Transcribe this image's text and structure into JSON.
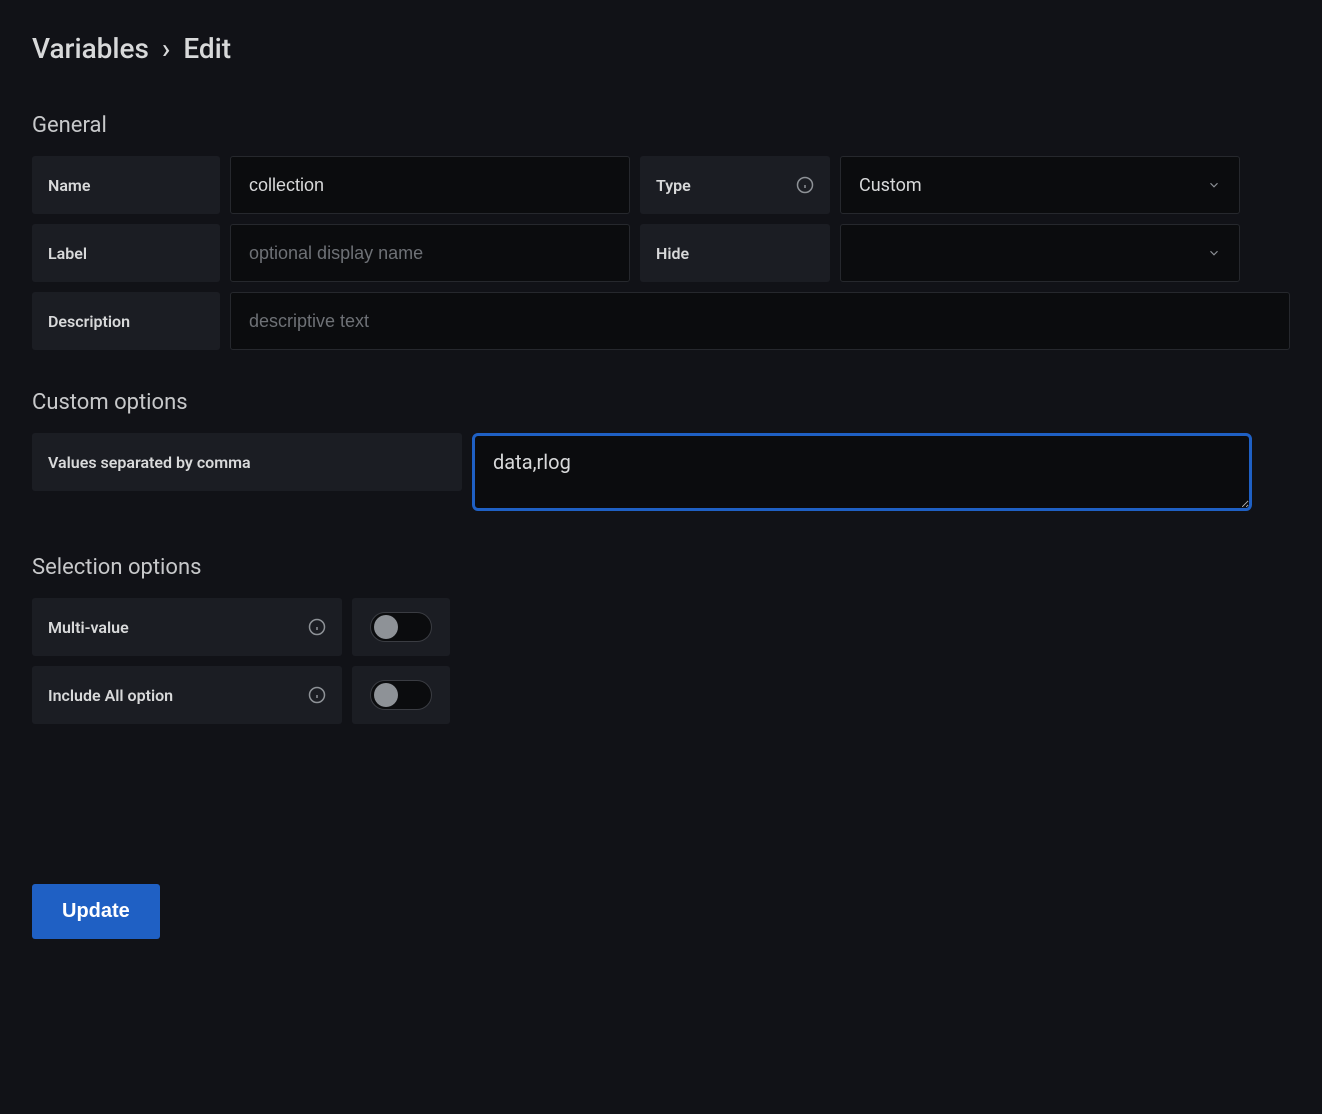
{
  "breadcrumb": {
    "root": "Variables",
    "sep": "›",
    "leaf": "Edit"
  },
  "sections": {
    "general": {
      "title": "General",
      "name_label": "Name",
      "name_value": "collection",
      "type_label": "Type",
      "type_value": "Custom",
      "label_label": "Label",
      "label_placeholder": "optional display name",
      "label_value": "",
      "hide_label": "Hide",
      "hide_value": "",
      "description_label": "Description",
      "description_placeholder": "descriptive text",
      "description_value": ""
    },
    "custom": {
      "title": "Custom options",
      "values_label": "Values separated by comma",
      "values_value": "data,rlog"
    },
    "selection": {
      "title": "Selection options",
      "multi_label": "Multi-value",
      "multi_on": false,
      "all_label": "Include All option",
      "all_on": false
    }
  },
  "actions": {
    "update": "Update"
  },
  "icons": {
    "info": "info-icon",
    "chevron": "chevron-down-icon"
  }
}
